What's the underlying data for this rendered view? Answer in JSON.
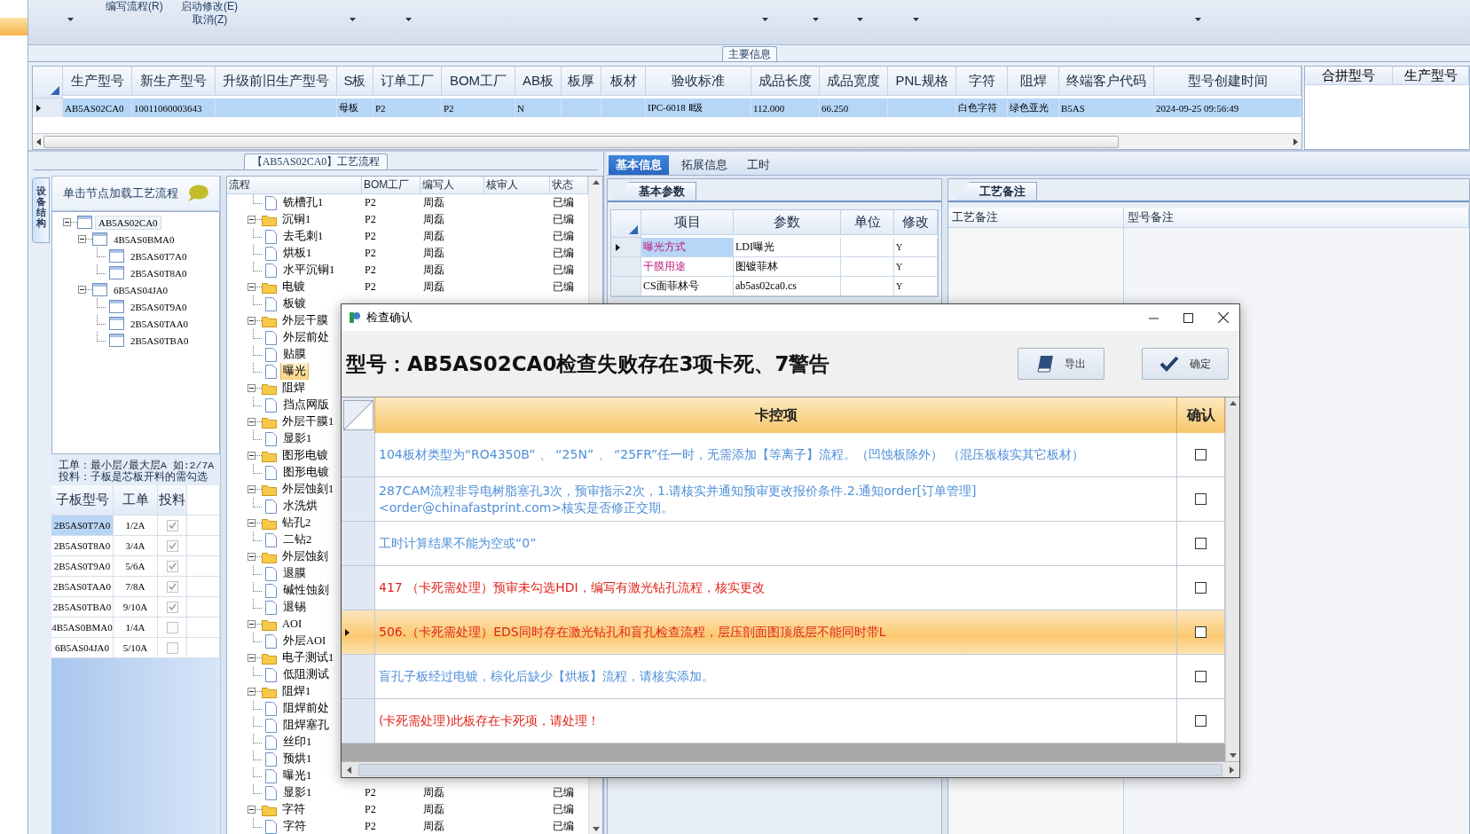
{
  "ribbon": {
    "commands": [
      {
        "label": "编写流程(R)"
      },
      {
        "label": "启动修改(E)"
      },
      {
        "label": "取消(Z)"
      }
    ]
  },
  "main_info": {
    "title": "主要信息",
    "row_selected": true,
    "columns": [
      {
        "label": "生产型号",
        "value": "AB5AS02CA0"
      },
      {
        "label": "新生产型号",
        "value": "10011060003643"
      },
      {
        "label": "升级前旧生产型号"
      },
      {
        "label": "S板",
        "value": "母板"
      },
      {
        "label": "订单工厂",
        "value": "P2"
      },
      {
        "label": "BOM工厂",
        "value": "P2"
      },
      {
        "label": "AB板",
        "value": "N"
      },
      {
        "label": "板厚"
      },
      {
        "label": "板材"
      },
      {
        "label": "验收标准",
        "value": "IPC-6018 Ⅱ级"
      },
      {
        "label": "成品长度",
        "value": "112.000"
      },
      {
        "label": "成品宽度",
        "value": "66.250"
      },
      {
        "label": "PNL规格"
      },
      {
        "label": "字符",
        "value": "白色字符"
      },
      {
        "label": "阻焊",
        "value": "绿色亚光"
      },
      {
        "label": "终端客户代码",
        "value": "B5AS"
      },
      {
        "label": "型号创建时间",
        "value": "2024-09-25 09:56:49"
      }
    ],
    "side_columns": [
      "合拼型号",
      "生产型号"
    ]
  },
  "flow_panel": {
    "title": "【AB5AS02CA0】工艺流程",
    "side_tab": "设备结构",
    "tree_caption": "单击节点加载工艺流程",
    "device_tree": [
      {
        "label": "AB5AS02CA0",
        "selected": true,
        "expanded": true,
        "children": [
          {
            "label": "4B5AS0BMA0",
            "selected": false,
            "expanded": true,
            "children": [
              {
                "label": "2B5AS0T7A0",
                "selected": false
              },
              {
                "label": "2B5AS0T8A0",
                "selected": false
              }
            ]
          },
          {
            "label": "6B5AS04JA0",
            "selected": false,
            "expanded": true,
            "children": [
              {
                "label": "2B5AS0T9A0",
                "selected": false
              },
              {
                "label": "2B5AS0TAA0",
                "selected": false
              },
              {
                "label": "2B5AS0TBA0",
                "selected": false
              }
            ]
          }
        ]
      }
    ],
    "notes": [
      "工单：最小层/最大层A 如:2/7A",
      "投料：子板是芯板开料的需勾选"
    ],
    "sub_table": {
      "columns": [
        "子板型号",
        "工单",
        "投料"
      ],
      "rows": [
        {
          "model": "2B5AS0T7A0",
          "work_order": "1/2A",
          "checked": true,
          "selected": true
        },
        {
          "model": "2B5AS0T8A0",
          "work_order": "3/4A",
          "checked": true,
          "selected": false
        },
        {
          "model": "2B5AS0T9A0",
          "work_order": "5/6A",
          "checked": true,
          "selected": false
        },
        {
          "model": "2B5AS0TAA0",
          "work_order": "7/8A",
          "checked": true,
          "selected": false
        },
        {
          "model": "2B5AS0TBA0",
          "work_order": "9/10A",
          "checked": true,
          "selected": false
        },
        {
          "model": "4B5AS0BMA0",
          "work_order": "1/4A",
          "checked": false,
          "selected": false
        },
        {
          "model": "6B5AS04JA0",
          "work_order": "5/10A",
          "checked": false,
          "selected": false
        }
      ]
    },
    "process_table": {
      "columns": [
        "流程",
        "BOM工厂",
        "编写人",
        "核审人",
        "状态"
      ],
      "tree": [
        {
          "children": [
            {
              "label": "铣槽孔1",
              "selected": false,
              "bom": "P2",
              "writer": "周磊",
              "status": "已编"
            }
          ]
        },
        {
          "label": "沉铜1",
          "selected": false,
          "expanded": true,
          "bom": "P2",
          "writer": "周磊",
          "status": "已编",
          "children": [
            {
              "label": "去毛刺1",
              "selected": false,
              "bom": "P2",
              "writer": "周磊",
              "status": "已编"
            },
            {
              "label": "烘板1",
              "selected": false,
              "bom": "P2",
              "writer": "周磊",
              "status": "已编"
            },
            {
              "label": "水平沉铜1",
              "selected": false,
              "bom": "P2",
              "writer": "周磊",
              "status": "已编"
            }
          ]
        },
        {
          "label": "电镀",
          "selected": false,
          "expanded": true,
          "bom": "P2",
          "writer": "周磊",
          "status": "已编",
          "children": [
            {
              "label": "板镀",
              "selected": false
            }
          ]
        },
        {
          "label": "外层干膜",
          "selected": false,
          "expanded": true,
          "children": [
            {
              "label": "外层前处",
              "selected": false
            },
            {
              "label": "贴膜",
              "selected": false
            },
            {
              "label": "曝光",
              "selected": true
            }
          ]
        },
        {
          "label": "阻焊",
          "selected": false,
          "expanded": true,
          "children": [
            {
              "label": "挡点网版",
              "selected": false
            }
          ]
        },
        {
          "label": "外层干膜1",
          "selected": false,
          "expanded": true,
          "children": [
            {
              "label": "显影1",
              "selected": false
            }
          ]
        },
        {
          "label": "图形电镀",
          "selected": false,
          "expanded": true,
          "children": [
            {
              "label": "图形电镀",
              "selected": false
            }
          ]
        },
        {
          "label": "外层蚀刻1",
          "selected": false,
          "expanded": true,
          "children": [
            {
              "label": "水洗烘",
              "selected": false
            }
          ]
        },
        {
          "label": "钻孔2",
          "selected": false,
          "expanded": true,
          "children": [
            {
              "label": "二钻2",
              "selected": false
            }
          ]
        },
        {
          "label": "外层蚀刻",
          "selected": false,
          "expanded": true,
          "children": [
            {
              "label": "退膜",
              "selected": false
            },
            {
              "label": "碱性蚀刻",
              "selected": false
            },
            {
              "label": "退锡",
              "selected": false
            }
          ]
        },
        {
          "label": "AOI",
          "selected": false,
          "expanded": true,
          "children": [
            {
              "label": "外层AOI",
              "selected": false
            }
          ]
        },
        {
          "label": "电子测试1",
          "selected": false,
          "expanded": true,
          "children": [
            {
              "label": "低阻测试",
              "selected": false
            }
          ]
        },
        {
          "label": "阻焊1",
          "selected": false,
          "expanded": true,
          "children": [
            {
              "label": "阻焊前处",
              "selected": false
            },
            {
              "label": "阻焊塞孔",
              "selected": false
            },
            {
              "label": "丝印1",
              "selected": false
            },
            {
              "label": "预烘1",
              "selected": false
            },
            {
              "label": "曝光1",
              "selected": false
            },
            {
              "label": "显影1",
              "selected": false,
              "bom": "P2",
              "writer": "周磊",
              "status": "已编"
            }
          ]
        },
        {
          "label": "字符",
          "selected": false,
          "expanded": true,
          "bom": "P2",
          "writer": "周磊",
          "status": "已编",
          "children": [
            {
              "label": "字符",
              "selected": false,
              "bom": "P2",
              "writer": "周磊",
              "status": "已编"
            }
          ]
        }
      ]
    }
  },
  "info_panel": {
    "tabs": [
      {
        "label": "基本信息",
        "selected": true
      },
      {
        "label": "拓展信息",
        "selected": false
      },
      {
        "label": "工时",
        "selected": false
      }
    ],
    "params_tab": "基本参数",
    "params_columns": [
      "项目",
      "参数",
      "单位",
      "修改"
    ],
    "params": [
      {
        "item": "曝光方式",
        "value": "LDI曝光",
        "modified": "Y",
        "required": true,
        "selected": true
      },
      {
        "item": "干膜用途",
        "value": "图镀菲林",
        "modified": "Y",
        "required": true,
        "selected": false
      },
      {
        "item": "CS面菲林号",
        "value": "ab5as02ca0.cs",
        "modified": "Y",
        "required": false,
        "selected": false
      }
    ],
    "notes_tab": "工艺备注",
    "notes_columns": [
      "工艺备注",
      "型号备注"
    ]
  },
  "dialog": {
    "title": "检查确认",
    "heading": "型号：AB5AS02CA0检查失败存在3项卡死、7警告",
    "buttons": [
      {
        "label": "导出",
        "kind": "export"
      },
      {
        "label": "确定",
        "kind": "ok"
      }
    ],
    "columns": [
      "卡控项",
      "确认"
    ],
    "rows": [
      {
        "text": "104板材类型为“RO4350B” 、 “25N” 、 “25FR”任一时，无需添加【等离子】流程。（凹蚀板除外） （混压板核实其它板材）",
        "kind": "warning",
        "selected": false,
        "checked": false
      },
      {
        "text": "287CAM流程非导电树脂塞孔3次，预审指示2次，1.请核实并通知预审更改报价条件.2.通知order[订单管理]\n<order@chinafastprint.com>核实是否修正交期。",
        "kind": "warning",
        "selected": false,
        "checked": false
      },
      {
        "text": "工时计算结果不能为空或“0”",
        "kind": "warning",
        "selected": false,
        "checked": false
      },
      {
        "text": "417 （卡死需处理）预审未勾选HDI，编写有激光钻孔流程，核实更改",
        "kind": "fatal",
        "selected": false,
        "checked": false
      },
      {
        "text": "506.（卡死需处理）EDS同时存在激光钻孔和盲孔检查流程，层压剖面图顶底层不能同时带L",
        "kind": "fatal",
        "selected": true,
        "checked": false
      },
      {
        "text": "盲孔子板经过电镀，棕化后缺少【烘板】流程，请核实添加。",
        "kind": "warning",
        "selected": false,
        "checked": false
      },
      {
        "text": "(卡死需处理)此板存在卡死项，请处理！",
        "kind": "fatal",
        "selected": false,
        "checked": false
      }
    ]
  }
}
